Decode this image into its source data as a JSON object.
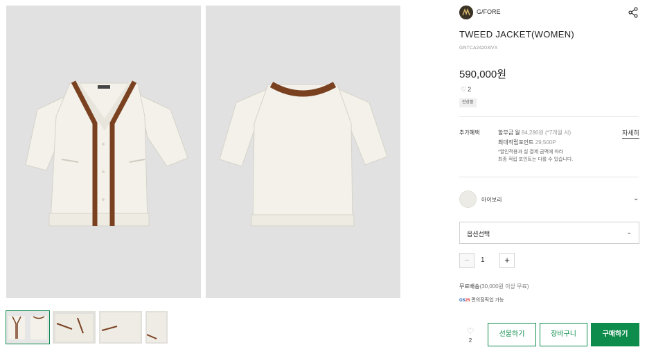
{
  "brand": {
    "name": "G/FORE",
    "logo_icon": "brand-logo-icon"
  },
  "product": {
    "title": "TWEED JACKET(WOMEN)",
    "code": "GNTCA24203IVX",
    "price": "590,000원",
    "like_count": "2",
    "tag": "전상품"
  },
  "benefits": {
    "label": "추가혜택",
    "installment": "할부금 월 ",
    "installment_amount": "84,286원 (*7개월 시)",
    "points_label": "최대적립포인트 ",
    "points_value": "29,500P",
    "note_line1": "*할인적용과 실 결제 금액에 따라",
    "note_line2": "최종 적립 포인트는 다를 수 있습니다.",
    "detail_link": "자세히"
  },
  "color_option": {
    "label": "아이보리",
    "swatch_color": "#ecebe5"
  },
  "option_select": {
    "label": "옵션선택"
  },
  "quantity": {
    "value": "1",
    "minus": "−",
    "plus": "+"
  },
  "shipping": {
    "text": "무료배송",
    "condition": "(30,000원 이상 무료)",
    "gs_logo_a": "GS",
    "gs_logo_b": "25",
    "gs_text": "편의점픽업 가능"
  },
  "actions": {
    "wish_count": "2",
    "gift": "선물하기",
    "cart": "장바구니",
    "buy": "구매하기"
  },
  "colors": {
    "accent": "#0d8c4b",
    "jacket": "#f3f1ea",
    "trim": "#7a4121"
  }
}
